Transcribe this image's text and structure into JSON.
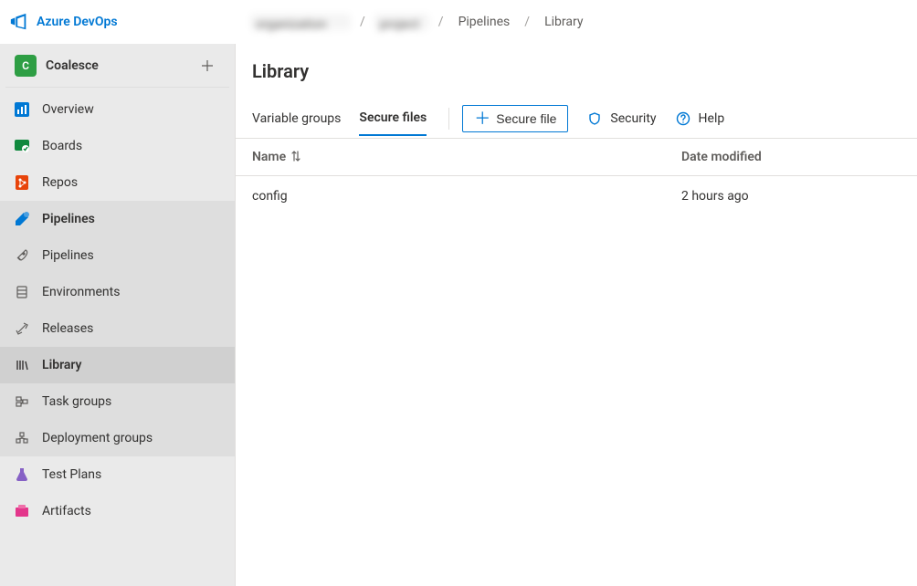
{
  "brand": "Azure DevOps",
  "breadcrumbs": {
    "item1": "organization",
    "item2": "project",
    "item3": "Pipelines",
    "item4": "Library"
  },
  "project": {
    "initial": "C",
    "name": "Coalesce"
  },
  "sidebar": {
    "overview": "Overview",
    "boards": "Boards",
    "repos": "Repos",
    "pipelines": "Pipelines",
    "sub_pipelines": "Pipelines",
    "sub_environments": "Environments",
    "sub_releases": "Releases",
    "sub_library": "Library",
    "sub_taskgroups": "Task groups",
    "sub_deploygroups": "Deployment groups",
    "testplans": "Test Plans",
    "artifacts": "Artifacts"
  },
  "page": {
    "title": "Library"
  },
  "tabs": {
    "variable_groups": "Variable groups",
    "secure_files": "Secure files"
  },
  "toolbar": {
    "secure_file_btn": "Secure file",
    "security": "Security",
    "help": "Help"
  },
  "table": {
    "head_name": "Name",
    "head_date": "Date modified",
    "rows": [
      {
        "name": "config",
        "date": "2 hours ago"
      }
    ]
  }
}
